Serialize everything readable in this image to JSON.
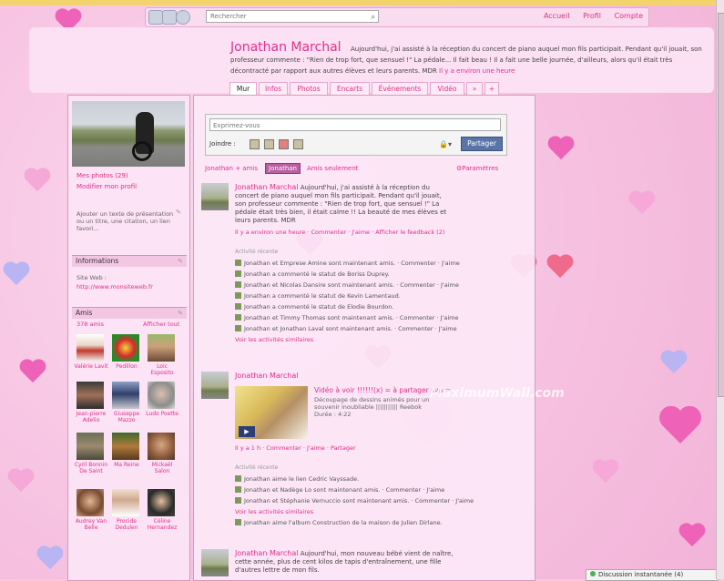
{
  "nav": {
    "search_placeholder": "Rechercher",
    "links": [
      "Accueil",
      "Profil",
      "Compte"
    ]
  },
  "profile": {
    "name": "Jonathan Marchal",
    "status": "Aujourd'hui, j'ai assisté à la réception du concert de piano auquel mon fils participait. Pendant qu'il jouait, son professeur commente : \"Rien de trop fort, que sensuel !\" La pédale... Il fait beau ! Il a fait une belle journée, d'ailleurs, alors qu'il était très décontracté par rapport aux autres élèves et leurs parents. MDR",
    "status_link": "Il y a environ une heure"
  },
  "tabs": [
    "Mur",
    "Infos",
    "Photos",
    "Encarts",
    "Événements",
    "Vidéo",
    "»",
    "+"
  ],
  "left": {
    "photos_link": "Mes photos (29)",
    "edit_link": "Modifier mon profil",
    "about": "Ajouter un texte de présentation ou un titre, une citation, un lien favori...",
    "info_header": "Informations",
    "site_label": "Site Web :",
    "site_url": "http://www.monsiteweb.fr",
    "friends_header": "Amis",
    "friends_count": "378 amis",
    "friends_all": "Afficher tout",
    "friends": [
      "Valérie Lavit",
      "Pedillon",
      "Loic Esposito",
      "Jean-pierre Adelio",
      "Giuseppe Mazzo",
      "Ludo Poette",
      "Cyril Bonnin De Saint",
      "Ma Reine",
      "Mickaël Salon",
      "Audrey Van Belle",
      "Procide Dedulen",
      "Céline Hernandez"
    ]
  },
  "composer": {
    "placeholder": "Exprimez-vous",
    "attach_label": "Joindre :",
    "share_button": "Partager"
  },
  "filters": [
    "Jonathan + amis",
    "Jonathan",
    "Amis seulement",
    "Paramètres"
  ],
  "posts": [
    {
      "author": "Jonathan Marchal",
      "text": "Aujourd'hui, j'ai assisté à la réception du concert de piano auquel mon fils participait. Pendant qu'il jouait, son professeur commente : \"Rien de trop fort, que sensuel !\" La pédale était très bien, il était calme !! La beauté de mes élèves et leurs parents. MDR",
      "meta": "Il y a environ une heure · Commenter · J'aime · Afficher le feedback (2)"
    },
    {
      "author": "Jonathan Marchal",
      "video_title": "Vidéo à voir !!!!!!(x) = à partager svp =",
      "video_desc": "Découpage de dessins animés pour un souvenir inoubliable ||||||||||| Reebok",
      "video_dur": "Durée : 4:22",
      "meta": "Il y a 1 h · Commenter · J'aime · Partager"
    },
    {
      "author": "Jonathan Marchal",
      "text": "Aujourd'hui, mon nouveau bébé vient de naître, cette année, plus de cent kilos de tapis d'entraînement, une fille d'autres lettre de mon fils."
    }
  ],
  "activity1": {
    "header": "Activité récente",
    "items": [
      "Jonathan et Emprese Amine sont maintenant amis. · Commenter · J'aime",
      "Jonathan a commenté le statut de Boriss Duprey.",
      "Jonathan et Nicolas Dansire sont maintenant amis. · Commenter · J'aime",
      "Jonathan a commenté le statut de Kevin Lamentaud.",
      "Jonathan a commenté le statut de Elodie Bourdon.",
      "Jonathan et Timmy Thomas sont maintenant amis. · Commenter · J'aime",
      "Jonathan et Jonathan Laval sont maintenant amis. · Commenter · J'aime"
    ],
    "more": "Voir les activités similaires"
  },
  "activity2": {
    "header": "Activité récente",
    "items": [
      "Jonathan aime le lien Cedric Vayssade.",
      "Jonathan et Nadège Lo sont maintenant amis. · Commenter · J'aime",
      "Jonathan et Stéphanie Vernuccio sont maintenant amis. · Commenter · J'aime",
      "Jonathan aime l'album Construction de la maison de Julien Dirlane."
    ],
    "more": "Voir les activités similaires"
  },
  "watermark": "MaximumWall.com",
  "chat": "Discussion instantanée (4)",
  "colors": {
    "accent": "#e0308a",
    "share": "#5b74a8",
    "panel": "#fce4f5"
  }
}
